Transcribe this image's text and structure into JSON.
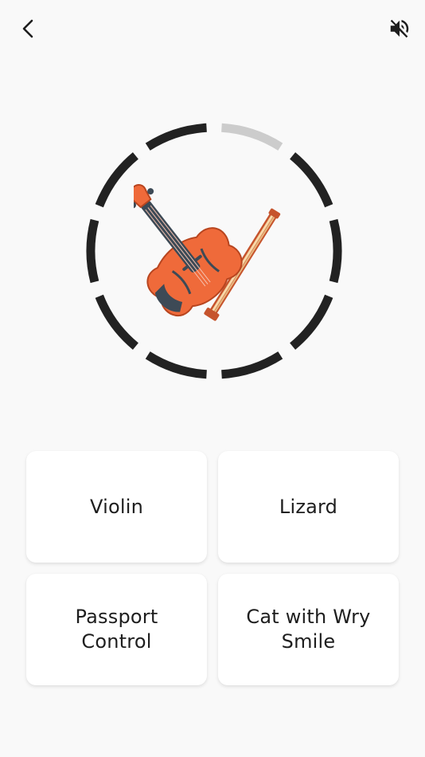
{
  "header": {
    "back_icon": "chevron-left-icon",
    "mute_icon": "speaker-muted-icon"
  },
  "timer": {
    "total_segments": 10,
    "elapsed_segments": 1,
    "remaining_fraction": 0.9,
    "active_color": "#222222",
    "elapsed_color": "#cccccc"
  },
  "question": {
    "image_icon": "violin-icon"
  },
  "answers": [
    {
      "label": "Violin"
    },
    {
      "label": "Lizard"
    },
    {
      "label": "Passport Control"
    },
    {
      "label": "Cat with Wry Smile"
    }
  ]
}
